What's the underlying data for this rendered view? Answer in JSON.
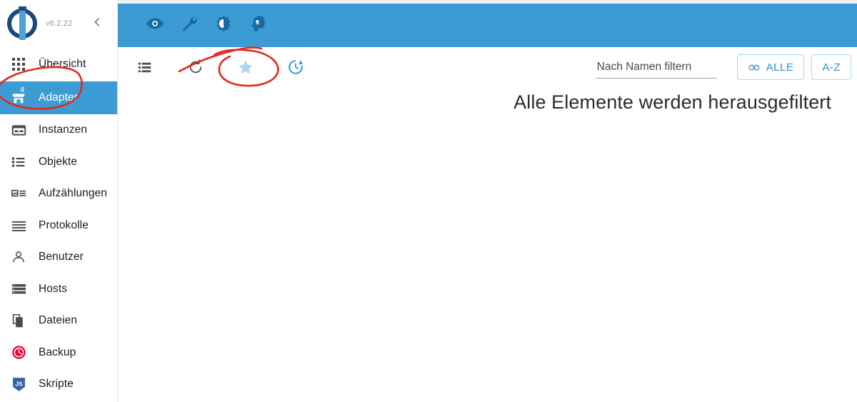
{
  "app": {
    "version": "v6.2.22",
    "logo_name": "iobroker-logo",
    "accent_blue": "#3d9bd4",
    "logo_dark": "#184a7d",
    "logo_light": "#4da3d8",
    "annotation_color": "#e02a1c"
  },
  "sidebar": {
    "collapse_icon": "chevron-left-icon",
    "items": [
      {
        "label": "Übersicht",
        "icon": "apps-grid-icon",
        "active": false,
        "badge": ""
      },
      {
        "label": "Adapter",
        "icon": "store-icon",
        "active": true,
        "badge": "4"
      },
      {
        "label": "Instanzen",
        "icon": "instances-icon",
        "active": false,
        "badge": ""
      },
      {
        "label": "Objekte",
        "icon": "list-objects-icon",
        "active": false,
        "badge": ""
      },
      {
        "label": "Aufzählungen",
        "icon": "enums-icon",
        "active": false,
        "badge": ""
      },
      {
        "label": "Protokolle",
        "icon": "logs-icon",
        "active": false,
        "badge": ""
      },
      {
        "label": "Benutzer",
        "icon": "person-icon",
        "active": false,
        "badge": ""
      },
      {
        "label": "Hosts",
        "icon": "hosts-icon",
        "active": false,
        "badge": ""
      },
      {
        "label": "Dateien",
        "icon": "files-icon",
        "active": false,
        "badge": ""
      },
      {
        "label": "Backup",
        "icon": "backup-clock-icon",
        "active": false,
        "badge": ""
      },
      {
        "label": "Skripte",
        "icon": "javascript-icon",
        "active": false,
        "badge": ""
      }
    ]
  },
  "topbar": {
    "icons": [
      {
        "name": "eye-icon",
        "title": "Sichtbarkeit"
      },
      {
        "name": "wrench-icon",
        "title": "Einstellungen"
      },
      {
        "name": "brightness-icon",
        "title": "Helligkeit"
      },
      {
        "name": "expert-head-icon",
        "title": "Expertenmodus"
      }
    ]
  },
  "toolbar": {
    "icons": [
      {
        "name": "view-list-icon",
        "title": "Ansicht"
      },
      {
        "name": "refresh-icon",
        "title": "Aktualisieren"
      },
      {
        "name": "star-icon",
        "title": "Favoriten"
      },
      {
        "name": "update-clock-icon",
        "title": "Updates"
      }
    ],
    "filter_placeholder": "Nach Namen filtern",
    "filter_value": "",
    "all_button_label": "ALLE",
    "all_button_icon": "infinity-icon",
    "sort_button_label": "A-Z"
  },
  "main": {
    "empty_message": "Alle Elemente werden herausgefiltert"
  }
}
